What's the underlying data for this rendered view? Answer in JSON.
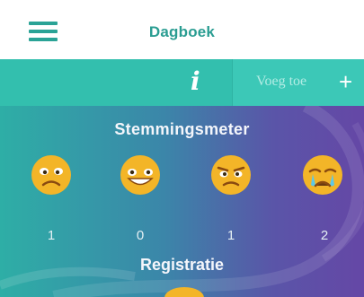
{
  "header": {
    "title": "Dagboek",
    "menu_icon": "hamburger-menu-icon"
  },
  "actionbar": {
    "info_glyph": "i",
    "add_label": "Voeg toe",
    "add_glyph": "+"
  },
  "mood_meter": {
    "heading": "Stemmingsmeter",
    "items": [
      {
        "icon": "sad-face-icon",
        "count": "1"
      },
      {
        "icon": "happy-face-icon",
        "count": "0"
      },
      {
        "icon": "angry-face-icon",
        "count": "1"
      },
      {
        "icon": "crying-face-icon",
        "count": "2"
      }
    ]
  },
  "registration": {
    "heading": "Registratie"
  },
  "colors": {
    "brand": "#2aa396",
    "actionbar": "#33bfae",
    "gradient_start": "#2eaea6",
    "gradient_end": "#6547a6",
    "emoji": "#f3b528"
  }
}
